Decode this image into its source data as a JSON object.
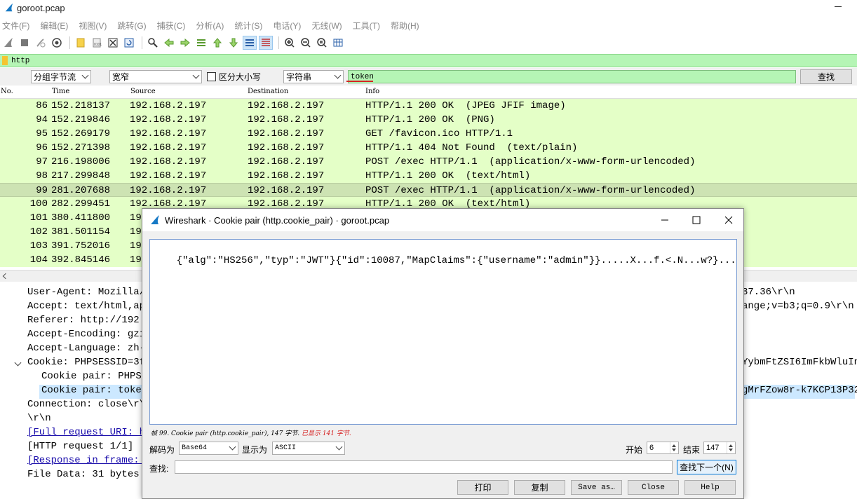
{
  "window": {
    "title": "goroot.pcap"
  },
  "menu": [
    "文件(F)",
    "编辑(E)",
    "视图(V)",
    "跳转(G)",
    "捕获(C)",
    "分析(A)",
    "统计(S)",
    "电话(Y)",
    "无线(W)",
    "工具(T)",
    "帮助(H)"
  ],
  "filter": {
    "value": "http"
  },
  "search": {
    "scope": "分组字节流",
    "charset": "宽窄",
    "case_label": "区分大小写",
    "type": "字符串",
    "value": "token",
    "find_button": "查找"
  },
  "columns": {
    "no": "No.",
    "time": "Time",
    "source": "Source",
    "destination": "Destination",
    "info": "Info"
  },
  "packets": [
    {
      "no": "86",
      "time": "152.218137",
      "src": "192.168.2.197",
      "dst": "192.168.2.197",
      "info": "HTTP/1.1 200 OK  (JPEG JFIF image)"
    },
    {
      "no": "94",
      "time": "152.219846",
      "src": "192.168.2.197",
      "dst": "192.168.2.197",
      "info": "HTTP/1.1 200 OK  (PNG)"
    },
    {
      "no": "95",
      "time": "152.269179",
      "src": "192.168.2.197",
      "dst": "192.168.2.197",
      "info": "GET /favicon.ico HTTP/1.1"
    },
    {
      "no": "96",
      "time": "152.271398",
      "src": "192.168.2.197",
      "dst": "192.168.2.197",
      "info": "HTTP/1.1 404 Not Found  (text/plain)"
    },
    {
      "no": "97",
      "time": "216.198006",
      "src": "192.168.2.197",
      "dst": "192.168.2.197",
      "info": "POST /exec HTTP/1.1  (application/x-www-form-urlencoded)"
    },
    {
      "no": "98",
      "time": "217.299848",
      "src": "192.168.2.197",
      "dst": "192.168.2.197",
      "info": "HTTP/1.1 200 OK  (text/html)"
    },
    {
      "no": "99",
      "time": "281.207688",
      "src": "192.168.2.197",
      "dst": "192.168.2.197",
      "info": "POST /exec HTTP/1.1  (application/x-www-form-urlencoded)"
    },
    {
      "no": "100",
      "time": "282.299451",
      "src": "192.168.2.197",
      "dst": "192.168.2.197",
      "info": "HTTP/1.1 200 OK  (text/html)"
    },
    {
      "no": "101",
      "time": "380.411800",
      "src": "19",
      "dst": "",
      "info": ""
    },
    {
      "no": "102",
      "time": "381.501154",
      "src": "19",
      "dst": "",
      "info": ""
    },
    {
      "no": "103",
      "time": "391.752016",
      "src": "19",
      "dst": "",
      "info": ""
    },
    {
      "no": "104",
      "time": "392.845146",
      "src": "19",
      "dst": "",
      "info": ""
    }
  ],
  "details": [
    {
      "text": "User-Agent: Mozilla/5",
      "right": "37.36\\r\\n"
    },
    {
      "text": "Accept: text/html,app",
      "right": "ange;v=b3;q=0.9\\r\\n"
    },
    {
      "text": "Referer: http://192.1",
      "right": ""
    },
    {
      "text": "Accept-Encoding: gzip",
      "right": ""
    },
    {
      "text": "Accept-Language: zh-C",
      "right": ""
    },
    {
      "text": "Cookie: PHPSESSID=3f8",
      "right": "YybmFtZSI6ImFkbWluIn1"
    },
    {
      "text": "Cookie pair: PHPSE",
      "right": ""
    },
    {
      "text": "Cookie pair: token",
      "right": "gMrFZow8r-k7KCP13P32s"
    },
    {
      "text": "Connection: close\\r\\n",
      "right": ""
    },
    {
      "text": "\\r\\n",
      "right": ""
    },
    {
      "text": "[Full request URI: ht",
      "right": ""
    },
    {
      "text": "[HTTP request 1/1]",
      "right": ""
    },
    {
      "text": "[Response in frame: 1",
      "right": ""
    },
    {
      "text": "File Data: 31 bytes",
      "right": ""
    }
  ],
  "dialog": {
    "title": "Wireshark · Cookie pair (http.cookie_pair) · goroot.pcap",
    "content": "{\"alg\":\"HS256\",\"typ\":\"JWT\"}{\"id\":10087,\"MapClaims\":{\"username\":\"admin\"}}.....X...f.<.N...w?}...S^...;.",
    "status_main": "帧 99. Cookie pair (http.cookie_pair), 147 字节.",
    "status_red": "已显示 141 字节.",
    "decode_label": "解码为",
    "decode_value": "Base64",
    "show_label": "显示为",
    "show_value": "ASCII",
    "start_label": "开始",
    "start_value": "6",
    "end_label": "结束",
    "end_value": "147",
    "find_label": "查找:",
    "find_next": "查找下一个(N)",
    "print": "打印",
    "copy": "复制",
    "save_as": "Save as…",
    "close": "Close",
    "help": "Help"
  }
}
